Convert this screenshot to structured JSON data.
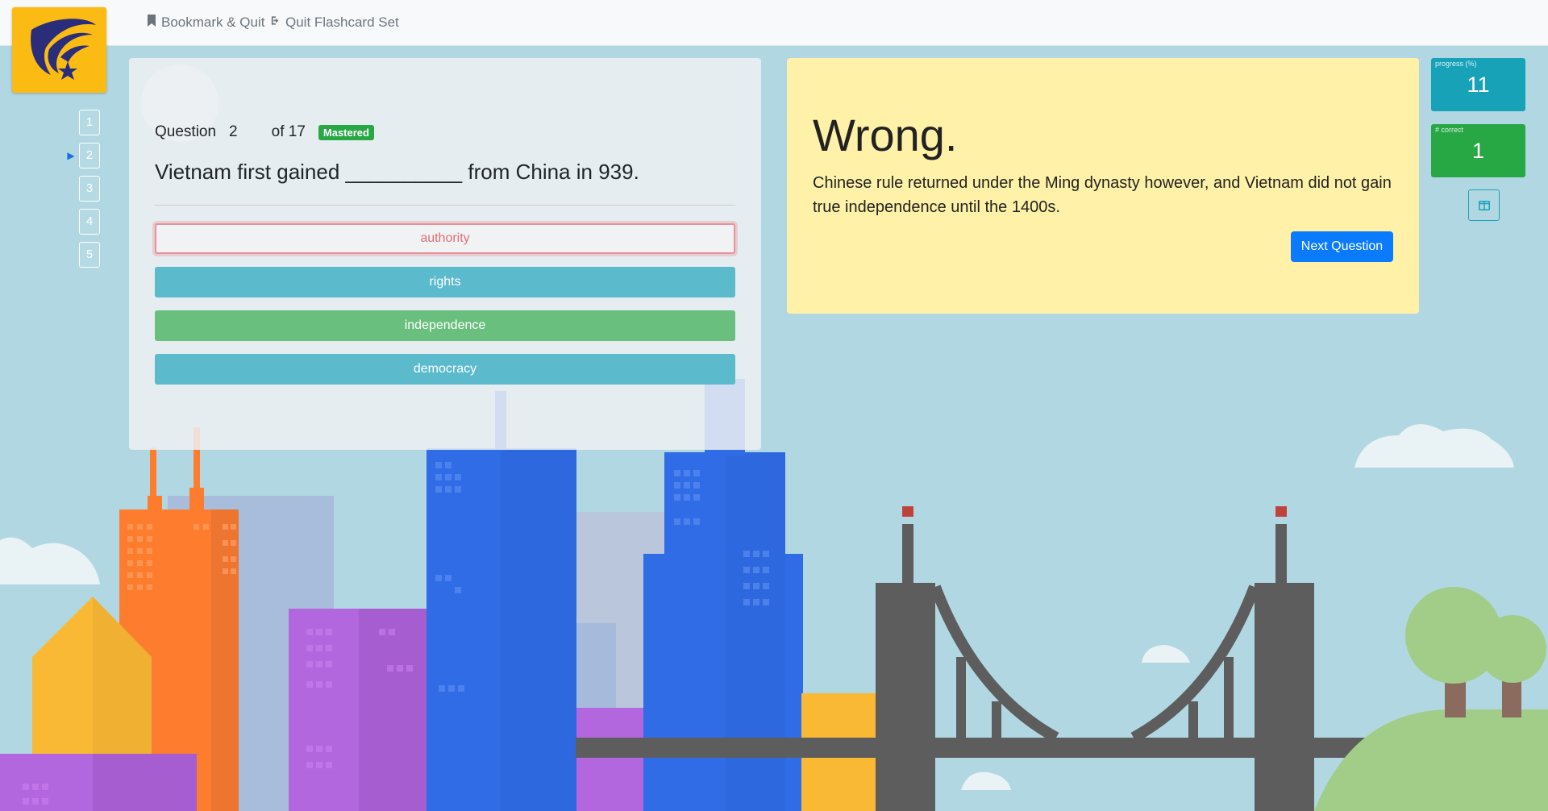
{
  "nav": {
    "bookmark_label": "Bookmark & Quit",
    "quit_label": "Quit Flashcard Set"
  },
  "question_nav": {
    "items": [
      "1",
      "2",
      "3",
      "4",
      "5"
    ],
    "current": "2"
  },
  "question": {
    "label": "Question",
    "number": "2",
    "of_label": "of 17",
    "status_badge": "Mastered",
    "text": "Vietnam first gained __________ from China in 939.",
    "answers": [
      {
        "label": "authority",
        "state": "wrong"
      },
      {
        "label": "rights",
        "state": "neutral"
      },
      {
        "label": "independence",
        "state": "correct"
      },
      {
        "label": "democracy",
        "state": "neutral"
      }
    ]
  },
  "feedback": {
    "title": "Wrong.",
    "explanation": "Chinese rule returned under the Ming dynasty however, and Vietnam did not gain true independence until the 1400s.",
    "next_label": "Next Question"
  },
  "stats": {
    "progress_label": "progress (%)",
    "progress_value": "11",
    "correct_label": "# correct",
    "correct_value": "1"
  },
  "icons": {
    "bookmark": "bookmark-icon",
    "quit": "sign-out-icon",
    "layout_toggle": "columns-icon",
    "logo": "logo-icon"
  },
  "colors": {
    "logo_bg": "#fcbb12",
    "progress": "#17a2b8",
    "correct": "#28a745",
    "next_button": "#0a7bff",
    "feedback_bg": "#fff2a8"
  }
}
